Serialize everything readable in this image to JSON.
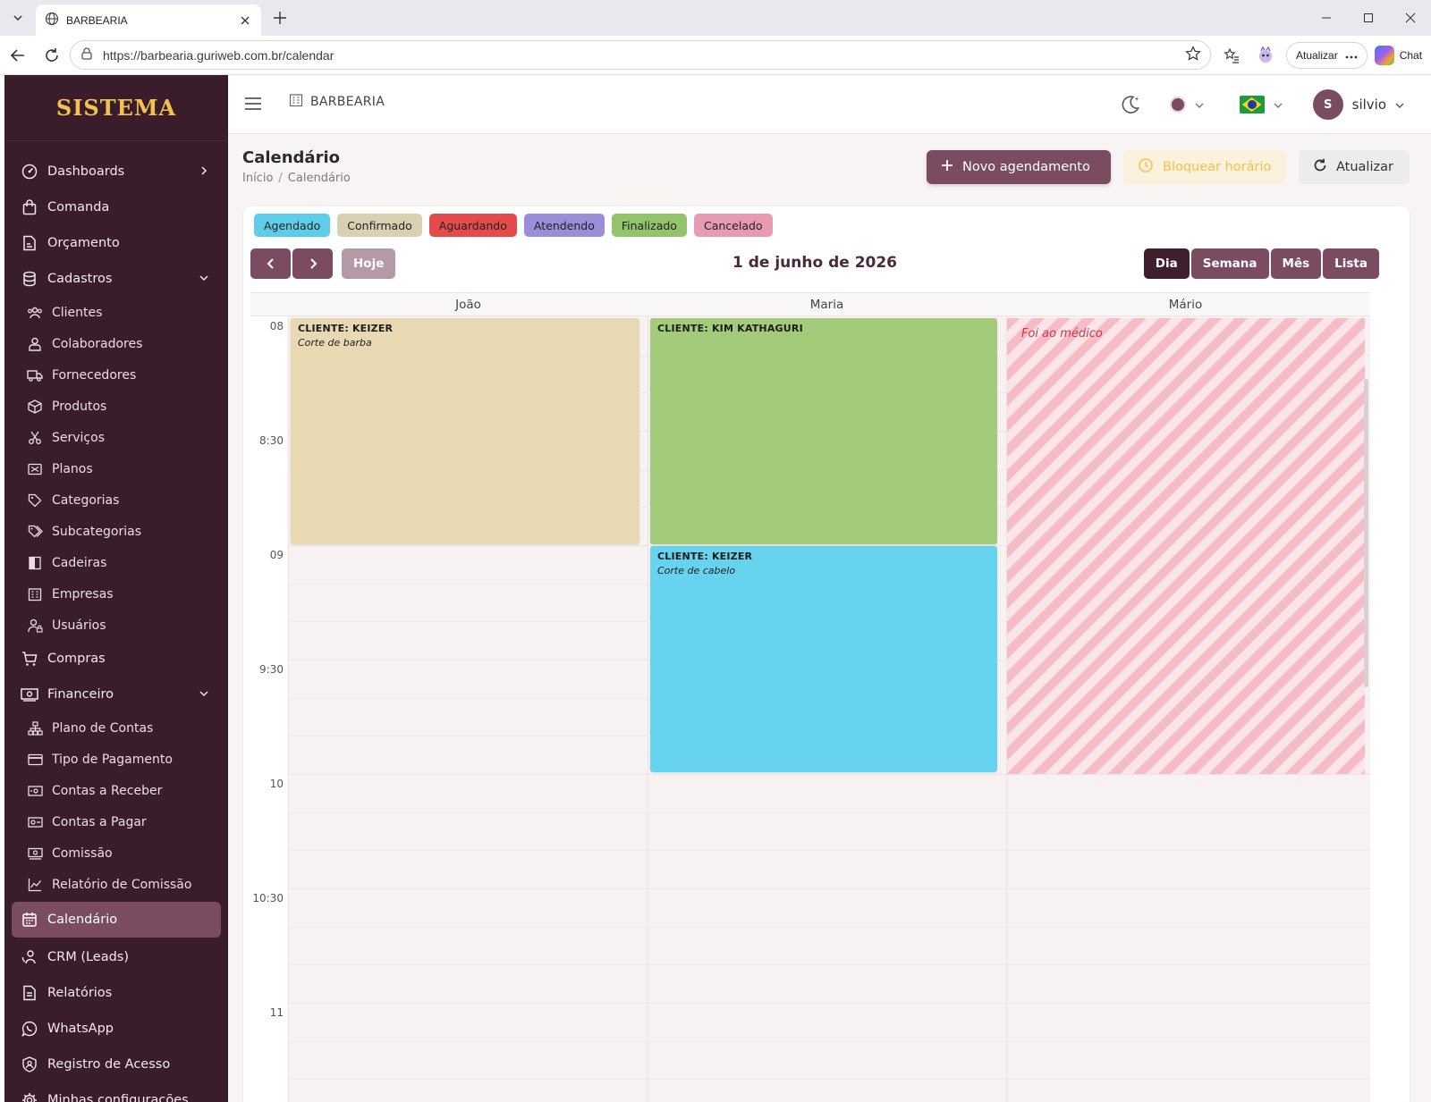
{
  "browser": {
    "tab_title": "BARBEARIA",
    "url": "https://barbearia.guriweb.com.br/calendar",
    "update_label": "Atualizar",
    "chat_label": "Chat"
  },
  "sidebar": {
    "brand": "SISTEMA",
    "items": [
      {
        "label": "Dashboards"
      },
      {
        "label": "Comanda"
      },
      {
        "label": "Orçamento"
      },
      {
        "label": "Cadastros"
      },
      {
        "label": "Clientes"
      },
      {
        "label": "Colaboradores"
      },
      {
        "label": "Fornecedores"
      },
      {
        "label": "Produtos"
      },
      {
        "label": "Serviços"
      },
      {
        "label": "Planos"
      },
      {
        "label": "Categorias"
      },
      {
        "label": "Subcategorias"
      },
      {
        "label": "Cadeiras"
      },
      {
        "label": "Empresas"
      },
      {
        "label": "Usuários"
      },
      {
        "label": "Compras"
      },
      {
        "label": "Financeiro"
      },
      {
        "label": "Plano de Contas"
      },
      {
        "label": "Tipo de Pagamento"
      },
      {
        "label": "Contas a Receber"
      },
      {
        "label": "Contas a Pagar"
      },
      {
        "label": "Comissão"
      },
      {
        "label": "Relatório de Comissão"
      },
      {
        "label": "Calendário"
      },
      {
        "label": "CRM (Leads)"
      },
      {
        "label": "Relatórios"
      },
      {
        "label": "WhatsApp"
      },
      {
        "label": "Registro de Acesso"
      },
      {
        "label": "Minhas configurações"
      }
    ]
  },
  "header": {
    "company": "BARBEARIA",
    "theme_color": "#7a4b61",
    "user_initial": "S",
    "user_name": "silvio"
  },
  "page": {
    "title": "Calendário",
    "breadcrumb": [
      "Início",
      "/",
      "Calendário"
    ],
    "new_button": "Novo agendamento",
    "block_button": "Bloquear horário",
    "refresh_button": "Atualizar"
  },
  "legend": [
    {
      "label": "Agendado",
      "color": "#5dcde9"
    },
    {
      "label": "Confirmado",
      "color": "#d9cfb1"
    },
    {
      "label": "Aguardando",
      "color": "#e44c4c"
    },
    {
      "label": "Atendendo",
      "color": "#9b8ed9"
    },
    {
      "label": "Finalizado",
      "color": "#93c36b"
    },
    {
      "label": "Cancelado",
      "color": "#e79bb0"
    }
  ],
  "calendar": {
    "today_label": "Hoje",
    "date_title": "1 de junho de 2026",
    "views": [
      "Dia",
      "Semana",
      "Mês",
      "Lista"
    ],
    "active_view": "Dia",
    "columns": [
      "João",
      "Maria",
      "Mário"
    ],
    "hours": [
      "08",
      "8:30",
      "09",
      "9:30",
      "10",
      "10:30",
      "11"
    ],
    "events": [
      {
        "column": "João",
        "start": "08:00",
        "end": "09:00",
        "client": "CLIENTE: KEIZER",
        "service": "Corte de barba",
        "color": "#e9d9b2"
      },
      {
        "column": "Maria",
        "start": "08:00",
        "end": "09:00",
        "client": "CLIENTE: KIM KATHAGURI",
        "service": "",
        "color": "#a3cb79"
      },
      {
        "column": "Maria",
        "start": "09:00",
        "end": "10:00",
        "client": "CLIENTE: KEIZER",
        "service": "Corte de cabelo",
        "color": "#66d4ee"
      }
    ],
    "blocked": {
      "column": "Mário",
      "start": "08:00",
      "end": "10:00",
      "reason": "Foi ao médico"
    }
  }
}
